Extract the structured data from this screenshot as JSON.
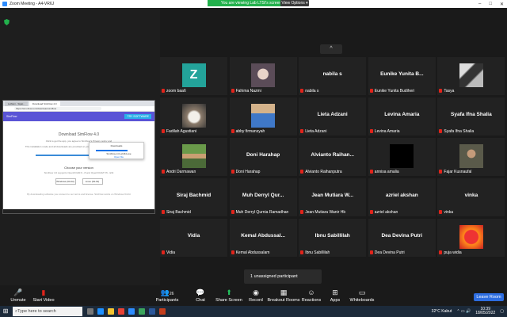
{
  "window": {
    "title": "Zoom Meeting - A4-VR6J"
  },
  "share_banner": "You are viewing Lab LTSI's screen",
  "view_options": "View Options",
  "shared_screen": {
    "tabs": [
      "Lutfiani - Sipat..",
      "Download SimFlow 4.0"
    ],
    "url": "https://sim-flow.com/download-simflow",
    "site_name": "SimFlow",
    "site_cta": "TRY SOFTWARE",
    "title": "Download SimFlow 4.0",
    "line1": "Click to get the app, you agree to SimFlow's Privacy policy and",
    "line2": "This installation mode and all downloads are provided on your system, and run on the latest Windows.",
    "choose_title": "Choose your version",
    "choose_sub": "SimFlow 4.0 supports OpenFOAM 9 - 8 and OpenFOAM 7/6 - ESI",
    "btn_windows": "Windows (64-bit)",
    "btn_linux": "Linux (64-bit)",
    "footer": "By downloading software you consent to our terms and license. SimFlow works on Windows 64-bit",
    "popup_title": "Downloads",
    "popup_file": "SimFlow-4.0-win64.exe",
    "popup_link": "Open file"
  },
  "up_chevron": "^",
  "participants": [
    {
      "name": "zoom baa6",
      "display": "",
      "pic": "z",
      "letter": "Z"
    },
    {
      "name": "Fahima Nazmi",
      "display": "",
      "pic": "hijab"
    },
    {
      "name": "nabila s",
      "display": "nabila s",
      "pic": ""
    },
    {
      "name": "Eunike Yunita Budiheri",
      "display": "Eunike Yunita B...",
      "pic": ""
    },
    {
      "name": "Tasya",
      "display": "",
      "pic": "bw"
    },
    {
      "name": "Fadilah Agustiani",
      "display": "",
      "pic": "cat"
    },
    {
      "name": "abby firmansyah",
      "display": "",
      "pic": "boy"
    },
    {
      "name": "Lieta Adzani",
      "display": "Lieta Adzani",
      "pic": ""
    },
    {
      "name": "Levina Amaria",
      "display": "Levina Amaria",
      "pic": ""
    },
    {
      "name": "Syafa Ifna Shalia",
      "display": "Syafa Ifna Shalia",
      "pic": ""
    },
    {
      "name": "Andri Darmawan",
      "display": "",
      "pic": "group"
    },
    {
      "name": "Doni Harahap",
      "display": "Doni Harahap",
      "pic": ""
    },
    {
      "name": "Alvianto Raihanputra",
      "display": "Alvianto Raihan...",
      "pic": ""
    },
    {
      "name": "annisa amalia",
      "display": "",
      "pic": "black"
    },
    {
      "name": "Fajar Kusnaufal",
      "display": "",
      "pic": "man"
    },
    {
      "name": "Siraj Bachmid",
      "display": "Siraj Bachmid",
      "pic": ""
    },
    {
      "name": "Muh Derryl Qurnia Ramadhan",
      "display": "Muh Derryl Qur...",
      "pic": ""
    },
    {
      "name": "Jean Mutiara Wanir Hb",
      "display": "Jean Mutiara W...",
      "pic": ""
    },
    {
      "name": "azriel akshan",
      "display": "azriel akshan",
      "pic": ""
    },
    {
      "name": "vinka",
      "display": "vinka",
      "pic": ""
    },
    {
      "name": "Vidia",
      "display": "Vidia",
      "pic": ""
    },
    {
      "name": "Kemal Abdussalam",
      "display": "Kemal Abdussal...",
      "pic": ""
    },
    {
      "name": "Ibnu Sabillilah",
      "display": "Ibnu Sabillilah",
      "pic": ""
    },
    {
      "name": "Dea Devina Putri",
      "display": "Dea Devina Putri",
      "pic": ""
    },
    {
      "name": "puja widia",
      "display": "",
      "pic": "elmo"
    }
  ],
  "toast": "1 unassigned participant",
  "toolbar": {
    "unmute": "Unmute",
    "start_video": "Start Video",
    "participants": "Participants",
    "participants_count": "26",
    "chat": "Chat",
    "share_screen": "Share Screen",
    "record": "Record",
    "breakout_rooms": "Breakout Rooms",
    "reactions": "Reactions",
    "apps": "Apps",
    "whiteboards": "Whiteboards",
    "leave": "Leave Room"
  },
  "taskbar": {
    "search_placeholder": "Type here to search",
    "weather": "32°C  Kabut",
    "time": "10:39",
    "date": "18/05/2022"
  }
}
